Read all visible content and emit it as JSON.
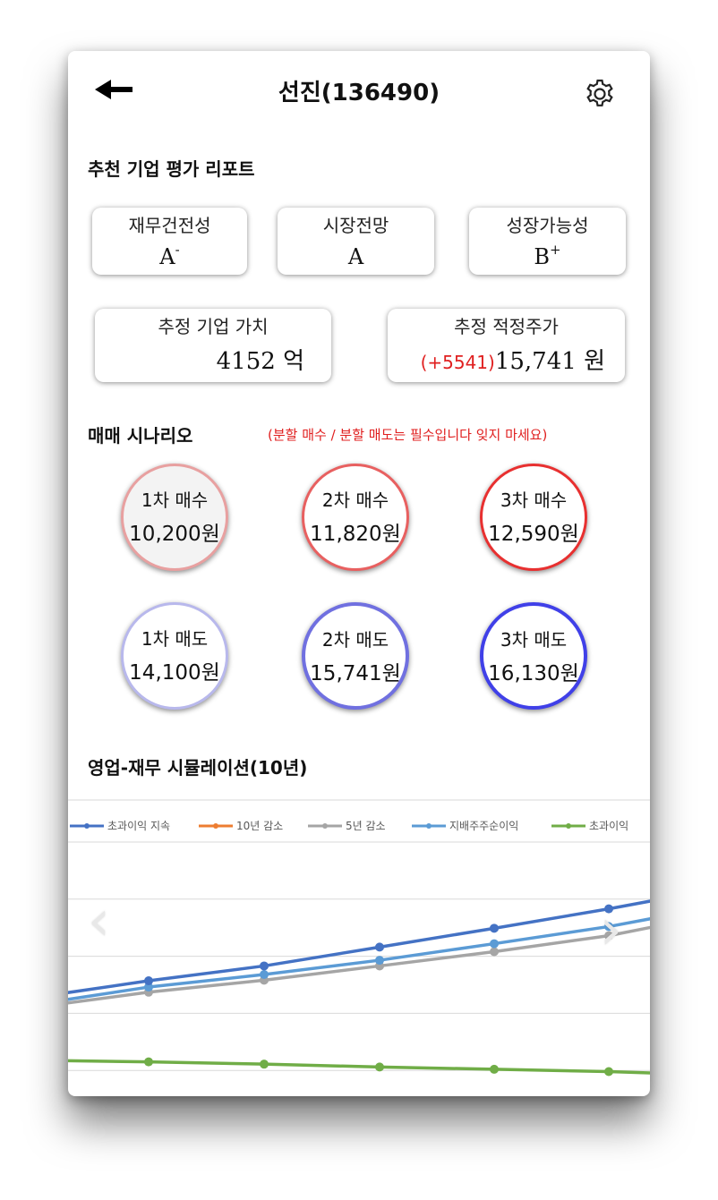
{
  "header": {
    "title": "선진(136490)",
    "back_icon": "arrow-left-icon",
    "settings_icon": "gear-icon"
  },
  "report": {
    "title": "추천 기업 평가 리포트",
    "grades": [
      {
        "label": "재무건전성",
        "grade": "A",
        "modifier": "-"
      },
      {
        "label": "시장전망",
        "grade": "A",
        "modifier": ""
      },
      {
        "label": "성장가능성",
        "grade": "B",
        "modifier": "+"
      }
    ],
    "value": {
      "label": "추정 기업 가치",
      "amount": "4152",
      "unit": "억"
    },
    "price": {
      "label": "추정 적정주가",
      "diff": "(+5541)",
      "amount": "15,741",
      "unit": "원"
    }
  },
  "scenario": {
    "title": "매매 시나리오",
    "notice": "(분할 매수 / 분할 매도는 필수입니다 잊지 마세요)",
    "buys": [
      {
        "label": "1차 매수",
        "price": "10,200원"
      },
      {
        "label": "2차 매수",
        "price": "11,820원"
      },
      {
        "label": "3차 매수",
        "price": "12,590원"
      }
    ],
    "sells": [
      {
        "label": "1차 매도",
        "price": "14,100원"
      },
      {
        "label": "2차 매도",
        "price": "15,741원"
      },
      {
        "label": "3차 매도",
        "price": "16,130원"
      }
    ],
    "colors": {
      "buy_borders": [
        "#e8a0a0",
        "#e86060",
        "#e83030"
      ],
      "buy_fill_first": "#f3f3f3",
      "sell_borders": [
        "#b8b8ec",
        "#7070e0",
        "#4040e8"
      ]
    }
  },
  "simulation": {
    "title": "영업-재무 시뮬레이션(10년)",
    "prev_icon": "chevron-left-icon",
    "next_icon": "chevron-right-icon"
  },
  "chart_data": {
    "type": "line",
    "legend_position": "top",
    "grid": true,
    "y_range": [
      0,
      5
    ],
    "x": [
      0,
      1,
      2,
      3,
      4,
      5,
      6
    ],
    "series": [
      {
        "name": "초과이익 지속",
        "color": "#4472c4",
        "values": [
          2.35,
          2.57,
          2.83,
          3.16,
          3.49,
          3.83,
          4.0
        ]
      },
      {
        "name": "10년 감소",
        "color": "#ed7d31",
        "values": []
      },
      {
        "name": "5년 감소",
        "color": "#a5a5a5",
        "values": [
          2.17,
          2.37,
          2.58,
          2.83,
          3.08,
          3.36,
          3.54
        ]
      },
      {
        "name": "지배주주순이익",
        "color": "#5b9bd5",
        "values": [
          2.23,
          2.46,
          2.68,
          2.93,
          3.22,
          3.52,
          3.69
        ]
      },
      {
        "name": "초과이익",
        "color": "#70ad47",
        "values": [
          1.17,
          1.15,
          1.11,
          1.06,
          1.02,
          0.98,
          0.95
        ]
      }
    ]
  }
}
